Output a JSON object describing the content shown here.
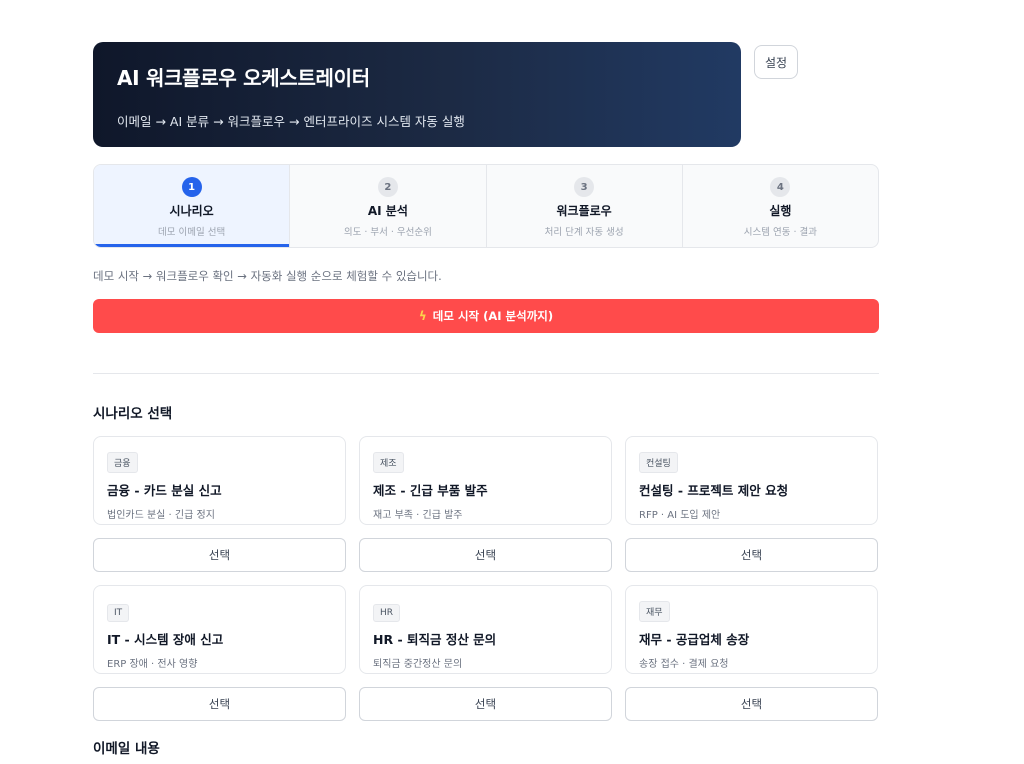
{
  "header": {
    "title": "AI 워크플로우 오케스트레이터",
    "subtitle": "이메일 → AI 분류 → 워크플로우 → 엔터프라이즈 시스템 자동 실행",
    "settings_label": "설정"
  },
  "steps": [
    {
      "num": "1",
      "title": "시나리오",
      "sub": "데모 이메일 선택",
      "active": true
    },
    {
      "num": "2",
      "title": "AI 분석",
      "sub": "의도 · 부서 · 우선순위",
      "active": false
    },
    {
      "num": "3",
      "title": "워크플로우",
      "sub": "처리 단계 자동 생성",
      "active": false
    },
    {
      "num": "4",
      "title": "실행",
      "sub": "시스템 연동 · 결과",
      "active": false
    }
  ],
  "hint": "데모 시작 → 워크플로우 확인 → 자동화 실행 순으로 체험할 수 있습니다.",
  "demo_button": {
    "icon": "lightning-icon",
    "label": "데모 시작 (AI 분석까지)"
  },
  "scenario_section": {
    "title": "시나리오 선택",
    "select_label": "선택",
    "cards": [
      {
        "tag": "금융",
        "title": "금융 - 카드 분실 신고",
        "desc": "법인카드 분실 · 긴급 정지"
      },
      {
        "tag": "제조",
        "title": "제조 - 긴급 부품 발주",
        "desc": "재고 부족 · 긴급 발주"
      },
      {
        "tag": "컨설팅",
        "title": "컨설팅 - 프로젝트 제안 요청",
        "desc": "RFP · AI 도입 제안"
      },
      {
        "tag": "IT",
        "title": "IT - 시스템 장애 신고",
        "desc": "ERP 장애 · 전사 영향"
      },
      {
        "tag": "HR",
        "title": "HR - 퇴직금 정산 문의",
        "desc": "퇴직금 중간정산 문의"
      },
      {
        "tag": "재무",
        "title": "재무 - 공급업체 송장",
        "desc": "송장 접수 · 결제 요청"
      }
    ]
  },
  "email_section": {
    "title": "이메일 내용"
  },
  "colors": {
    "accent": "#2563eb",
    "demo_button": "#ff4b4b",
    "hero_dark": "#0f172a"
  }
}
